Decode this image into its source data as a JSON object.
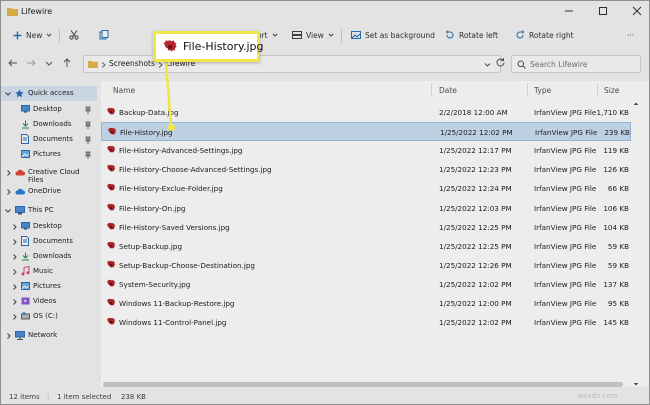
{
  "window": {
    "title": "Lifewire"
  },
  "toolbar": {
    "new_label": "New",
    "view_label": "View",
    "sort_label": "ort",
    "set_background_label": "Set as background",
    "rotate_left_label": "Rotate left",
    "rotate_right_label": "Rotate right",
    "more_label": "···"
  },
  "address": {
    "crumbs": [
      "Screenshots",
      "Lifewire"
    ]
  },
  "search": {
    "placeholder": "Search Lifewire"
  },
  "sidebar": {
    "items": [
      {
        "label": "Quick access",
        "icon": "star-icon"
      },
      {
        "label": "Desktop",
        "icon": "desktop-icon"
      },
      {
        "label": "Downloads",
        "icon": "download-icon"
      },
      {
        "label": "Documents",
        "icon": "document-icon"
      },
      {
        "label": "Pictures",
        "icon": "pictures-icon"
      },
      {
        "label": "Creative Cloud Files",
        "icon": "creative-cloud-icon"
      },
      {
        "label": "OneDrive",
        "icon": "cloud-icon"
      },
      {
        "label": "This PC",
        "icon": "pc-icon"
      },
      {
        "label": "Desktop",
        "icon": "desktop-icon"
      },
      {
        "label": "Documents",
        "icon": "document-icon"
      },
      {
        "label": "Downloads",
        "icon": "download-icon"
      },
      {
        "label": "Music",
        "icon": "music-icon"
      },
      {
        "label": "Pictures",
        "icon": "pictures-icon"
      },
      {
        "label": "Videos",
        "icon": "video-icon"
      },
      {
        "label": "OS (C:)",
        "icon": "drive-icon"
      },
      {
        "label": "Network",
        "icon": "network-icon"
      }
    ]
  },
  "columns": {
    "name": "Name",
    "date": "Date",
    "type": "Type",
    "size": "Size"
  },
  "files": [
    {
      "name": "Backup-Data.jpg",
      "date": "2/2/2018 12:00 AM",
      "type": "IrfanView JPG File",
      "size": "1,710 KB"
    },
    {
      "name": "File-History.jpg",
      "date": "1/25/2022 12:02 PM",
      "type": "IrfanView JPG File",
      "size": "239 KB"
    },
    {
      "name": "File-History-Advanced-Settings.jpg",
      "date": "1/25/2022 12:17 PM",
      "type": "IrfanView JPG File",
      "size": "119 KB"
    },
    {
      "name": "File-History-Choose-Advanced-Settings.jpg",
      "date": "1/25/2022 12:23 PM",
      "type": "IrfanView JPG File",
      "size": "126 KB"
    },
    {
      "name": "File-History-Exclue-Folder.jpg",
      "date": "1/25/2022 12:24 PM",
      "type": "IrfanView JPG File",
      "size": "66 KB"
    },
    {
      "name": "File-History-On.jpg",
      "date": "1/25/2022 12:03 PM",
      "type": "IrfanView JPG File",
      "size": "106 KB"
    },
    {
      "name": "File-History-Saved Versions.jpg",
      "date": "1/25/2022 12:25 PM",
      "type": "IrfanView JPG File",
      "size": "104 KB"
    },
    {
      "name": "Setup-Backup.jpg",
      "date": "1/25/2022 12:25 PM",
      "type": "IrfanView JPG File",
      "size": "59 KB"
    },
    {
      "name": "Setup-Backup-Choose-Destination.jpg",
      "date": "1/25/2022 12:26 PM",
      "type": "IrfanView JPG File",
      "size": "59 KB"
    },
    {
      "name": "System-Security.jpg",
      "date": "1/25/2022 12:02 PM",
      "type": "IrfanView JPG File",
      "size": "137 KB"
    },
    {
      "name": "Windows 11-Backup-Restore.jpg",
      "date": "1/25/2022 12:00 PM",
      "type": "IrfanView JPG File",
      "size": "95 KB"
    },
    {
      "name": "Windows 11-Control-Panel.jpg",
      "date": "1/25/2022 12:02 PM",
      "type": "IrfanView JPG File",
      "size": "145 KB"
    }
  ],
  "status": {
    "items": "12 items",
    "selected": "1 item selected",
    "size": "238 KB"
  },
  "callout": {
    "text": "File-History.jpg"
  },
  "watermark": "wsxdn.com",
  "colors": {
    "selection": "#cde1f5",
    "callout_border": "#f2e54a",
    "icon_red": "#b3262b"
  }
}
